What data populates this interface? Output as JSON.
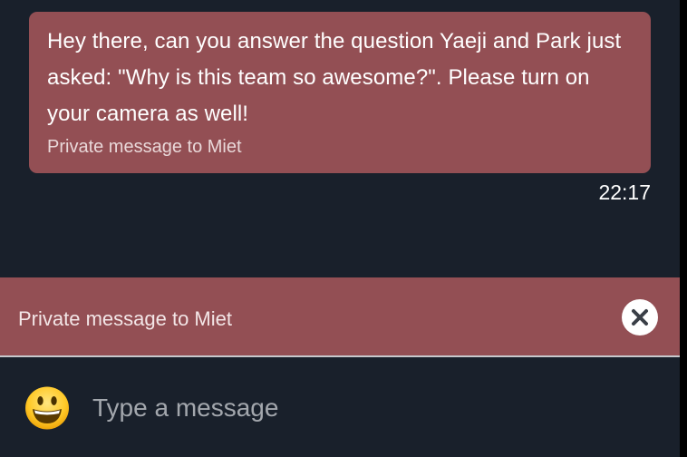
{
  "message": {
    "text": "Hey there, can you answer the question Yaeji and Park just asked: \"Why is this team so awesome?\". Please turn on your camera as well!",
    "subtext": "Private message to Miet",
    "time": "22:17"
  },
  "private_bar": {
    "label": "Private message to Miet",
    "close_icon": "close-circle-icon"
  },
  "composer": {
    "emoji_icon": "smiley-emoji-icon",
    "placeholder": "Type a message",
    "value": ""
  },
  "colors": {
    "background": "#19202b",
    "private_accent": "#934f54",
    "text": "#ffffff",
    "placeholder": "#a3a7ad"
  }
}
